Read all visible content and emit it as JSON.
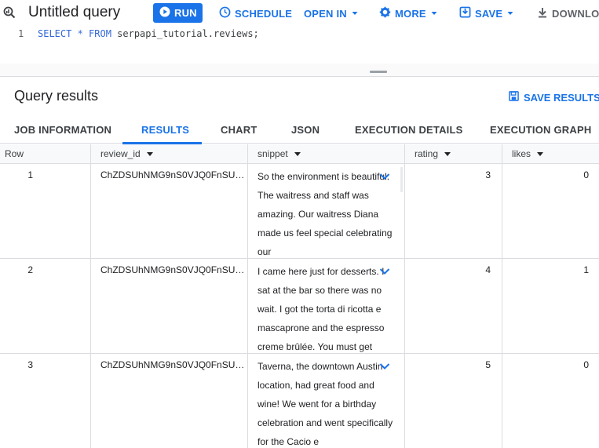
{
  "toolbar": {
    "title": "Untitled query",
    "run_label": "RUN",
    "schedule_label": "SCHEDULE",
    "open_in_label": "OPEN IN",
    "more_label": "MORE",
    "save_label": "SAVE",
    "download_label": "DOWNLOA"
  },
  "editor": {
    "line_number": "1",
    "code_keywords": "SELECT * FROM",
    "code_rest": " serpapi_tutorial.reviews;"
  },
  "results": {
    "title": "Query results",
    "save_results_label": "SAVE RESULTS"
  },
  "tabs": [
    {
      "label": "JOB INFORMATION"
    },
    {
      "label": "RESULTS"
    },
    {
      "label": "CHART"
    },
    {
      "label": "JSON"
    },
    {
      "label": "EXECUTION DETAILS"
    },
    {
      "label": "EXECUTION GRAPH"
    }
  ],
  "table": {
    "columns": [
      "Row",
      "review_id",
      "snippet",
      "rating",
      "likes"
    ],
    "rows": [
      {
        "row": "1",
        "review_id": "ChZDSUhNMG9nS0VJQ0FnSU…",
        "snippet": "So the environment is beautiful. The waitress and staff was amazing. Our waitress Diana made us feel special celebrating our",
        "rating": "3",
        "likes": "0"
      },
      {
        "row": "2",
        "review_id": "ChZDSUhNMG9nS0VJQ0FnSU…",
        "snippet": "I came here just for desserts. I sat at the bar so there was no wait. I got the torta di ricotta e mascaprone and the espresso creme brûlée. You must get",
        "rating": "4",
        "likes": "1"
      },
      {
        "row": "3",
        "review_id": "ChZDSUhNMG9nS0VJQ0FnSU…",
        "snippet": "Taverna, the downtown Austin location, had great food and wine! We went for a birthday celebration and went specifically for the Cacio e",
        "rating": "5",
        "likes": "0"
      }
    ]
  },
  "colors": {
    "accent": "#1a73e8",
    "border": "#dadce0",
    "header_bg": "#f8f9fa"
  }
}
